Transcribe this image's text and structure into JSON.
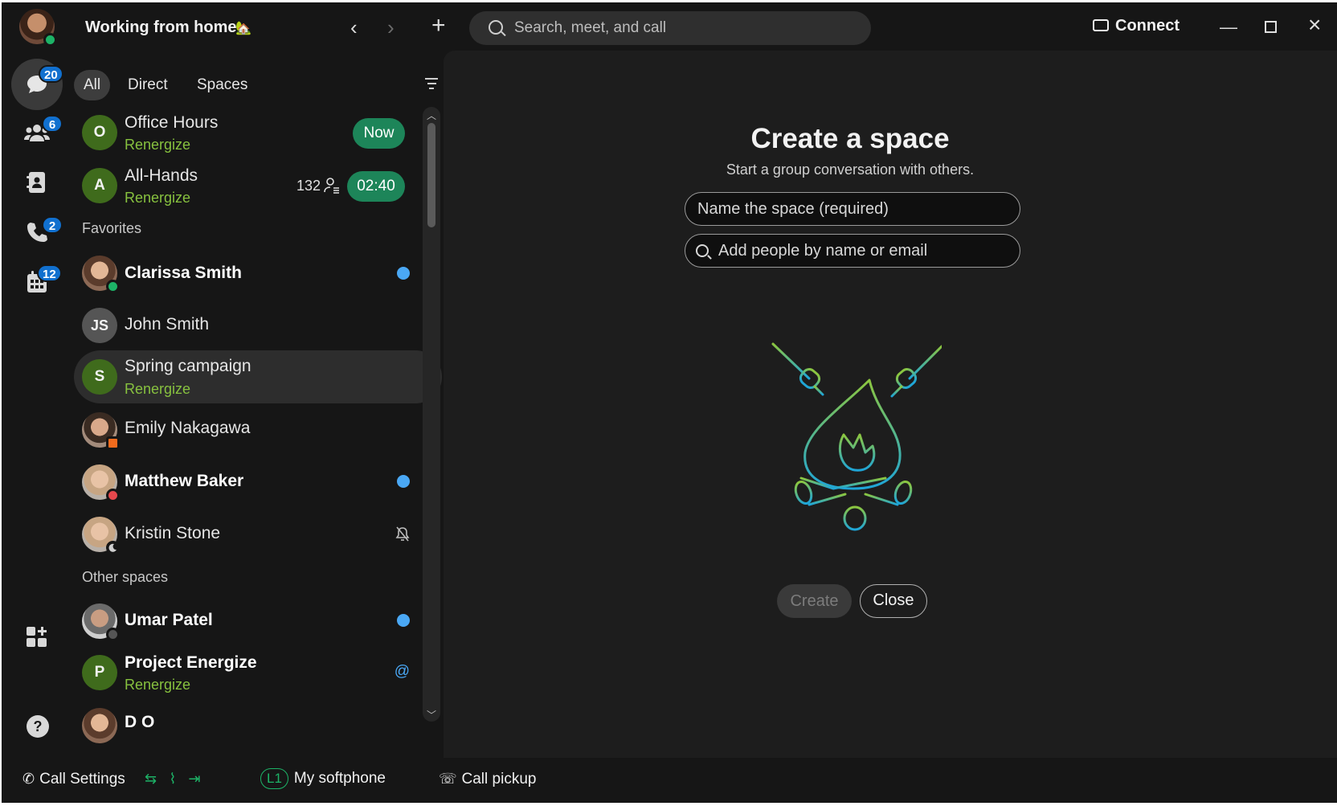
{
  "header": {
    "status_text": "Working from home",
    "status_emoji": "🏡",
    "search_placeholder": "Search, meet, and call",
    "connect_label": "Connect"
  },
  "rail": {
    "messaging_badge": "20",
    "teams_badge": "6",
    "calling_badge": "2",
    "meetings_badge": "12",
    "help_label": "?"
  },
  "filters": {
    "all": "All",
    "direct": "Direct",
    "spaces": "Spaces"
  },
  "list": {
    "office_hours": {
      "initial": "O",
      "name": "Office Hours",
      "sub": "Renergize",
      "pill": "Now"
    },
    "all_hands": {
      "initial": "A",
      "name": "All-Hands",
      "sub": "Renergize",
      "count": "132",
      "pill": "02:40"
    },
    "favorites_label": "Favorites",
    "clarissa": {
      "name": "Clarissa Smith"
    },
    "john": {
      "initials": "JS",
      "name": "John Smith"
    },
    "spring": {
      "initial": "S",
      "name": "Spring campaign",
      "sub": "Renergize"
    },
    "emily": {
      "name": "Emily Nakagawa"
    },
    "matthew": {
      "name": "Matthew Baker"
    },
    "kristin": {
      "name": "Kristin Stone"
    },
    "other_spaces_label": "Other spaces",
    "umar": {
      "name": "Umar Patel"
    },
    "project": {
      "initial": "P",
      "name": "Project Energize",
      "sub": "Renergize"
    },
    "partial_name": "D        O"
  },
  "create_space": {
    "title": "Create a space",
    "subtitle": "Start a group conversation with others.",
    "name_placeholder": "Name the space (required)",
    "people_placeholder": "Add people by name or email",
    "create_label": "Create",
    "close_label": "Close"
  },
  "bottom": {
    "call_settings": "Call Settings",
    "line": "L1",
    "softphone": "My softphone",
    "call_pickup": "Call pickup"
  },
  "colors": {
    "accent_green": "#1d8559",
    "space_green": "#3f6b1c",
    "renergize_text": "#87c13f",
    "badge_blue": "#1170cf",
    "unread_blue": "#4aa8f5"
  }
}
